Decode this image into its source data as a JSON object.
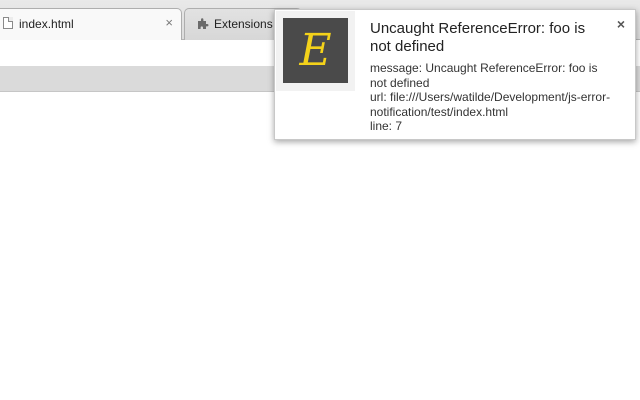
{
  "tabs": [
    {
      "title": "index.html",
      "icon": "page-icon",
      "close": "×"
    },
    {
      "title": "Extensions",
      "icon": "puzzle-icon"
    }
  ],
  "notification": {
    "title": "Uncaught ReferenceError: foo is not defined",
    "icon": "error-e-icon",
    "icon_letter": "E",
    "icon_color": "#f4d21a",
    "icon_background": "#4a4a4a",
    "close": "×",
    "body_lines": [
      "message: Uncaught ReferenceError: foo is not defined",
      "url: file:///Users/watilde/Development/js-error-notification/test/index.html",
      "line: 7"
    ]
  }
}
